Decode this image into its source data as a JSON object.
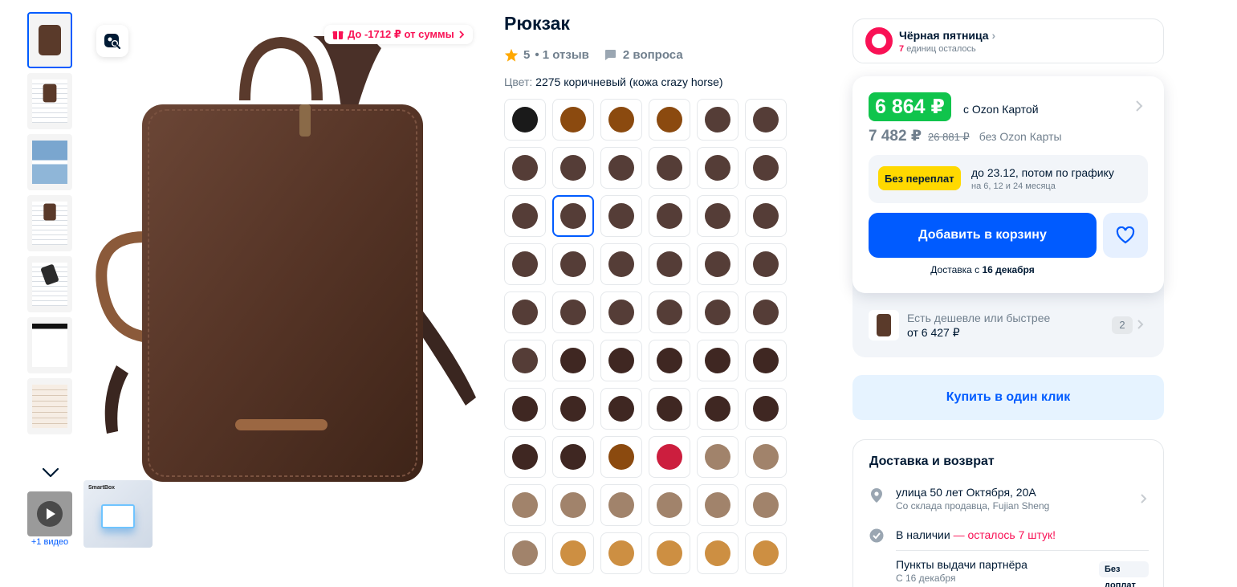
{
  "product": {
    "title": "Рюкзак",
    "rating": "5",
    "reviews": "• 1 отзыв",
    "questions": "2 вопроса",
    "color_label": "Цвет:",
    "color_value": "2275 коричневый (кожа crazy horse)"
  },
  "gallery": {
    "discount_badge": "До -1712 ₽ от суммы",
    "video_label": "+1 видео",
    "smartbox_label": "SmartBox"
  },
  "swatches": [
    "#1a1a1a",
    "#8b4a0f",
    "#8b4a0f",
    "#8b4a0f",
    "#553d37",
    "#553d37",
    "#553d37",
    "#553d37",
    "#553d37",
    "#553d37",
    "#553d37",
    "#553d37",
    "#553d37",
    "#553d37",
    "#553d37",
    "#553d37",
    "#553d37",
    "#553d37",
    "#553d37",
    "#553d37",
    "#553d37",
    "#553d37",
    "#553d37",
    "#553d37",
    "#553d37",
    "#553d37",
    "#553d37",
    "#553d37",
    "#553d37",
    "#553d37",
    "#553d37",
    "#3f2722",
    "#3f2722",
    "#3f2722",
    "#3f2722",
    "#3f2722",
    "#3f2722",
    "#3f2722",
    "#3f2722",
    "#3f2722",
    "#3f2722",
    "#3f2722",
    "#3f2722",
    "#3f2722",
    "#8b4a0f",
    "#cc1e3e",
    "#a1836b",
    "#a1836b",
    "#a1836b",
    "#a1836b",
    "#a1836b",
    "#a1836b",
    "#a1836b",
    "#a1836b",
    "#a1836b",
    "#cd8f42",
    "#cd8f42",
    "#cd8f42",
    "#cd8f42",
    "#cd8f42"
  ],
  "selected_swatch": 13,
  "black_friday": {
    "title": "Чёрная пятница",
    "count": "7",
    "remaining": "единиц осталось"
  },
  "price": {
    "ozon_card_price": "6 864 ₽",
    "ozon_card_label": "с Ozon Картой",
    "regular_price": "7 482 ₽",
    "old_price": "26 881 ₽",
    "no_card_label": "без Ozon Карты"
  },
  "installment": {
    "badge": "Без переплат",
    "line1": "до 23.12, потом по графику",
    "line2": "на 6, 12 и 24 месяца"
  },
  "actions": {
    "add_to_cart": "Добавить в корзину",
    "delivery_prefix": "Доставка с",
    "delivery_date": "16 декабря",
    "buy_one_click": "Купить в один клик"
  },
  "cheaper": {
    "line1": "Есть дешевле или быстрее",
    "line2": "от 6 427 ₽",
    "count": "2"
  },
  "delivery": {
    "title": "Доставка и возврат",
    "address": "улица 50 лет Октября, 20А",
    "address_sub": "Со склада продавца, Fujian Sheng",
    "stock_prefix": "В наличии",
    "stock_warning": "— осталось 7 штук!",
    "pickup": "Пункты выдачи партнёра",
    "pickup_date": "С 16 декабря",
    "pickup_badge": "Без доплат"
  },
  "colors": {
    "accent": "#005bff",
    "pink": "#f91155",
    "green": "#10c44c",
    "yellow": "#ffd900"
  }
}
